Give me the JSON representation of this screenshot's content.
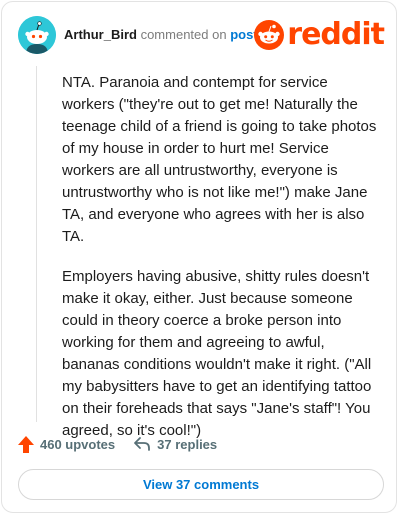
{
  "header": {
    "username": "Arthur_Bird",
    "commented_on": "commented on",
    "post_link": "post",
    "logo_text": "reddit"
  },
  "comment": {
    "paragraphs": [
      "NTA. Paranoia and contempt for service workers (\"they're out to get me! Naturally the teenage child of a friend is going to take photos of my house in order to hurt me! Service workers are all untrustworthy, everyone is untrustworthy who is not like me!\") make Jane TA, and everyone who agrees with her is also TA.",
      "Employers having abusive, shitty rules doesn't make it okay, either. Just because someone could in theory coerce a broke person into working for them and agreeing to awful, bananas conditions wouldn't make it right. (\"All my babysitters have to get an identifying tattoo on their foreheads that says \"Jane's staff\"! You agreed, so it's cool!\")"
    ]
  },
  "actions": {
    "upvotes": "460 upvotes",
    "replies": "37 replies"
  },
  "view_button": "View 37 comments",
  "colors": {
    "brand": "#ff4500",
    "link": "#0079d3",
    "avatar": "#2ec7d8",
    "muted": "#576f76"
  },
  "icons": [
    "snoo-avatar-icon",
    "reddit-logo-icon",
    "upvote-arrow-icon",
    "reply-arrow-icon"
  ]
}
